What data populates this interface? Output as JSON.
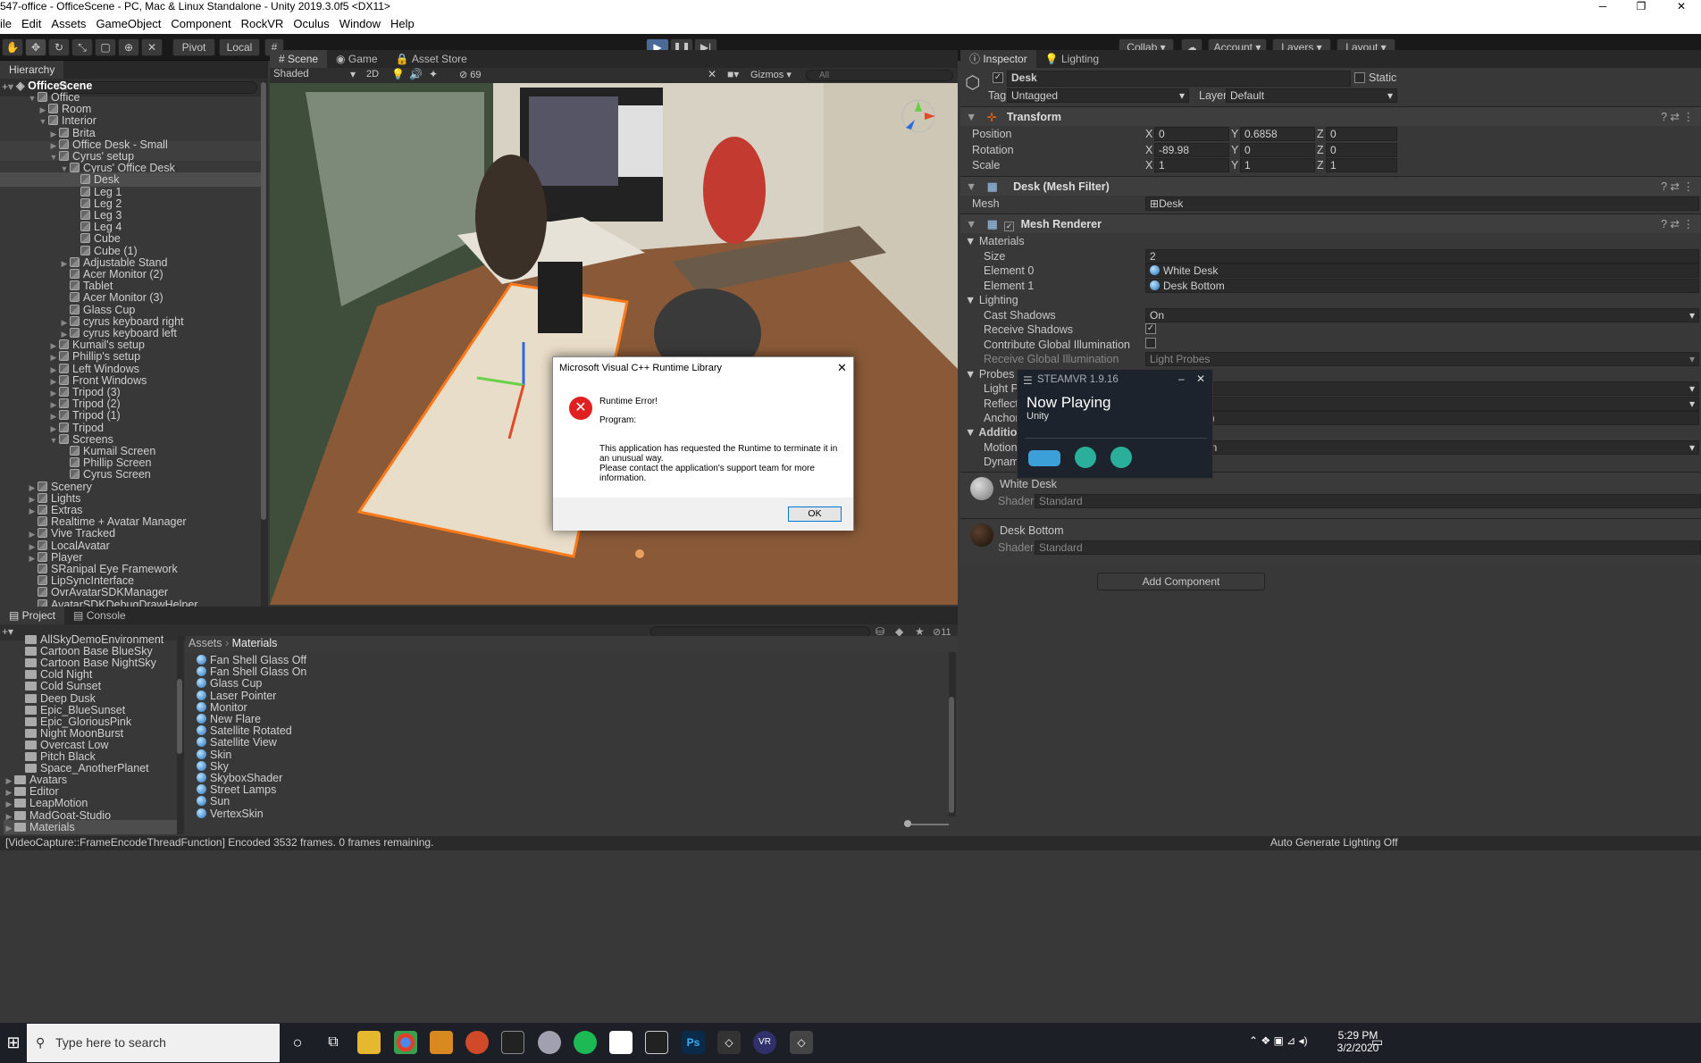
{
  "window": {
    "title": "547-office - OfficeScene - PC, Mac & Linux Standalone - Unity 2019.3.0f5 <DX11>"
  },
  "menu": [
    "ile",
    "Edit",
    "Assets",
    "GameObject",
    "Component",
    "RockVR",
    "Oculus",
    "Window",
    "Help"
  ],
  "toolbar": {
    "pivot": "Pivot",
    "local": "Local",
    "collab": "Collab",
    "account": "Account",
    "layers": "Layers",
    "layout": "Layout"
  },
  "hierarchy": {
    "tab": "Hierarchy",
    "search_placeholder": "All",
    "scene": "OfficeScene",
    "items": [
      {
        "label": "Office",
        "depth": 1,
        "arrow": "down"
      },
      {
        "label": "Room",
        "depth": 2,
        "arrow": "right"
      },
      {
        "label": "Interior",
        "depth": 2,
        "arrow": "down"
      },
      {
        "label": "Brita",
        "depth": 3,
        "arrow": "right"
      },
      {
        "label": "Office Desk - Small",
        "depth": 3,
        "arrow": "right"
      },
      {
        "label": "Cyrus' setup",
        "depth": 3,
        "arrow": "down"
      },
      {
        "label": "Cyrus' Office Desk",
        "depth": 4,
        "arrow": "down"
      },
      {
        "label": "Desk",
        "depth": 5,
        "arrow": "",
        "selected": true
      },
      {
        "label": "Leg 1",
        "depth": 5,
        "arrow": ""
      },
      {
        "label": "Leg 2",
        "depth": 5,
        "arrow": ""
      },
      {
        "label": "Leg 3",
        "depth": 5,
        "arrow": ""
      },
      {
        "label": "Leg 4",
        "depth": 5,
        "arrow": ""
      },
      {
        "label": "Cube",
        "depth": 5,
        "arrow": ""
      },
      {
        "label": "Cube (1)",
        "depth": 5,
        "arrow": ""
      },
      {
        "label": "Adjustable Stand",
        "depth": 4,
        "arrow": "right"
      },
      {
        "label": "Acer Monitor (2)",
        "depth": 4,
        "arrow": ""
      },
      {
        "label": "Tablet",
        "depth": 4,
        "arrow": ""
      },
      {
        "label": "Acer Monitor (3)",
        "depth": 4,
        "arrow": ""
      },
      {
        "label": "Glass Cup",
        "depth": 4,
        "arrow": ""
      },
      {
        "label": "cyrus keyboard right",
        "depth": 4,
        "arrow": "right"
      },
      {
        "label": "cyrus keyboard left",
        "depth": 4,
        "arrow": "right"
      },
      {
        "label": "Kumail's setup",
        "depth": 3,
        "arrow": "right"
      },
      {
        "label": "Phillip's setup",
        "depth": 3,
        "arrow": "right"
      },
      {
        "label": "Left Windows",
        "depth": 3,
        "arrow": "right"
      },
      {
        "label": "Front Windows",
        "depth": 3,
        "arrow": "right"
      },
      {
        "label": "Tripod (3)",
        "depth": 3,
        "arrow": "right"
      },
      {
        "label": "Tripod (2)",
        "depth": 3,
        "arrow": "right"
      },
      {
        "label": "Tripod (1)",
        "depth": 3,
        "arrow": "right"
      },
      {
        "label": "Tripod",
        "depth": 3,
        "arrow": "right"
      },
      {
        "label": "Screens",
        "depth": 3,
        "arrow": "down"
      },
      {
        "label": "Kumail Screen",
        "depth": 4,
        "arrow": ""
      },
      {
        "label": "Phillip Screen",
        "depth": 4,
        "arrow": ""
      },
      {
        "label": "Cyrus Screen",
        "depth": 4,
        "arrow": ""
      },
      {
        "label": "Scenery",
        "depth": 1,
        "arrow": "right"
      },
      {
        "label": "Lights",
        "depth": 1,
        "arrow": "right"
      },
      {
        "label": "Extras",
        "depth": 1,
        "arrow": "right"
      },
      {
        "label": "Realtime + Avatar Manager",
        "depth": 1,
        "arrow": ""
      },
      {
        "label": "Vive Tracked",
        "depth": 1,
        "arrow": "right"
      },
      {
        "label": "LocalAvatar",
        "depth": 1,
        "arrow": "right"
      },
      {
        "label": "Player",
        "depth": 1,
        "arrow": "right"
      },
      {
        "label": "SRanipal Eye Framework",
        "depth": 1,
        "arrow": ""
      },
      {
        "label": "LipSyncInterface",
        "depth": 1,
        "arrow": ""
      },
      {
        "label": "OvrAvatarSDKManager",
        "depth": 1,
        "arrow": ""
      },
      {
        "label": "AvatarSDKDebugDrawHelper",
        "depth": 1,
        "arrow": ""
      }
    ]
  },
  "scene": {
    "tabs": [
      "Scene",
      "Game",
      "Asset Store"
    ],
    "shading": "Shaded",
    "mode2d": "2D",
    "layers_count": "69",
    "gizmos": "Gizmos",
    "search_placeholder": "All"
  },
  "inspector": {
    "tabs": [
      "Inspector",
      "Lighting"
    ],
    "object_name": "Desk",
    "static_label": "Static",
    "tag_label": "Tag",
    "tag": "Untagged",
    "layer_label": "Layer",
    "layer": "Default",
    "transform": {
      "title": "Transform",
      "position_label": "Position",
      "position": {
        "x": "0",
        "y": "0.6858",
        "z": "0"
      },
      "rotation_label": "Rotation",
      "rotation": {
        "x": "-89.98",
        "y": "0",
        "z": "0"
      },
      "scale_label": "Scale",
      "scale": {
        "x": "1",
        "y": "1",
        "z": "1"
      }
    },
    "mesh_filter": {
      "title": "Desk (Mesh Filter)",
      "mesh_label": "Mesh",
      "mesh": "Desk"
    },
    "mesh_renderer": {
      "title": "Mesh Renderer",
      "materials_label": "Materials",
      "size_label": "Size",
      "size": "2",
      "element0_label": "Element 0",
      "element0": "White Desk",
      "element1_label": "Element 1",
      "element1": "Desk Bottom",
      "lighting_label": "Lighting",
      "cast_shadows_label": "Cast Shadows",
      "cast_shadows": "On",
      "receive_shadows_label": "Receive Shadows",
      "contribute_gi_label": "Contribute Global Illumination",
      "receive_gi_label": "Receive Global Illumination",
      "receive_gi": "Light Probes",
      "probes_label": "Probes",
      "light_probes_label": "Light Pr",
      "reflection_label": "Reflecti",
      "anchor_label": "Anchor",
      "anchor_value": "n)",
      "additional_label": "Additiona",
      "motion_label": "Motion V",
      "motion_value": "on",
      "dynamic_label": "Dynami"
    },
    "material1": {
      "name": "White Desk",
      "shader_label": "Shader",
      "shader": "Standard"
    },
    "material2": {
      "name": "Desk Bottom",
      "shader_label": "Shader",
      "shader": "Standard"
    },
    "add_component": "Add Component"
  },
  "steamvr": {
    "title": "STEAMVR 1.9.16",
    "now_playing": "Now Playing",
    "app": "Unity"
  },
  "dialog": {
    "title": "Microsoft Visual C++ Runtime Library",
    "error_title": "Runtime Error!",
    "program": "Program:",
    "message1": "This application has requested the Runtime to terminate it in an unusual way.",
    "message2": "Please contact the application's support team for more information.",
    "ok": "OK"
  },
  "project": {
    "tabs": [
      "Project",
      "Console"
    ],
    "count": "11",
    "folders": [
      "AllSkyDemoEnvironment",
      "Cartoon Base BlueSky",
      "Cartoon Base NightSky",
      "Cold Night",
      "Cold Sunset",
      "Deep Dusk",
      "Epic_BlueSunset",
      "Epic_GloriousPink",
      "Night MoonBurst",
      "Overcast Low",
      "Pitch Black",
      "Space_AnotherPlanet"
    ],
    "root_folders": [
      "Avatars",
      "Editor",
      "LeapMotion",
      "MadGoat-Studio",
      "Materials"
    ],
    "breadcrumb": [
      "Assets",
      "Materials"
    ],
    "assets": [
      "Fan Shell Glass Off",
      "Fan Shell Glass On",
      "Glass Cup",
      "Laser Pointer",
      "Monitor",
      "New Flare",
      "Satellite Rotated",
      "Satellite View",
      "Skin",
      "Sky",
      "SkyboxShader",
      "Street Lamps",
      "Sun",
      "VertexSkin"
    ]
  },
  "status": {
    "message": "[VideoCapture::FrameEncodeThreadFunction] Encoded 3532 frames. 0 frames remaining.",
    "right": "Auto Generate Lighting Off"
  },
  "taskbar": {
    "search_placeholder": "Type here to search",
    "time": "5:29 PM",
    "date": "3/2/2020"
  }
}
